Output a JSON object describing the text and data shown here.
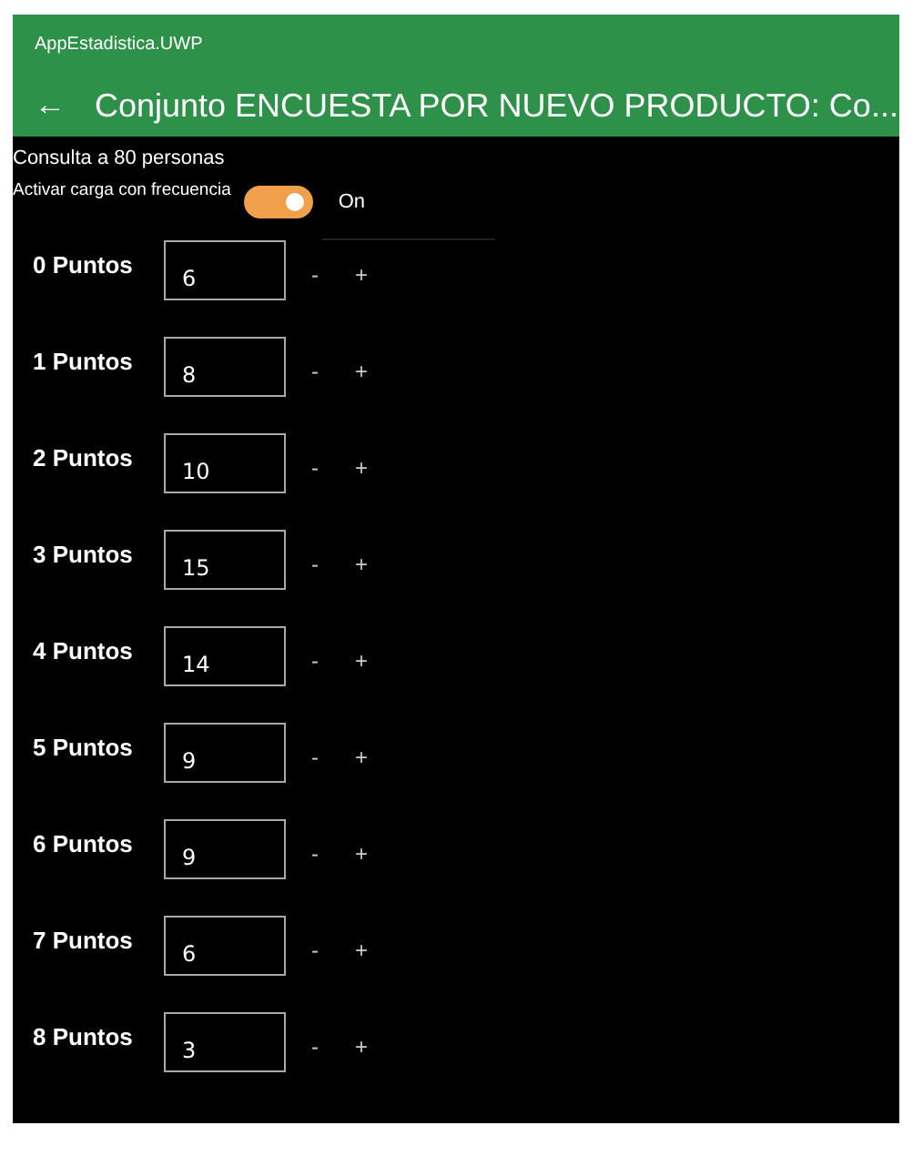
{
  "window": {
    "title": "AppEstadistica.UWP"
  },
  "header": {
    "back": "←",
    "title": "Conjunto ENCUESTA POR NUEVO PRODUCTO: Co..."
  },
  "summary": "Consulta a 80 personas",
  "toggle": {
    "label": "Activar carga con frecuencia",
    "on": true,
    "state_text": "On"
  },
  "rows": [
    {
      "label": "0 Puntos",
      "value": "6",
      "minus": "-",
      "plus": "+"
    },
    {
      "label": "1 Puntos",
      "value": "8",
      "minus": "-",
      "plus": "+"
    },
    {
      "label": "2 Puntos",
      "value": "10",
      "minus": "-",
      "plus": "+"
    },
    {
      "label": "3 Puntos",
      "value": "15",
      "minus": "-",
      "plus": "+"
    },
    {
      "label": "4 Puntos",
      "value": "14",
      "minus": "-",
      "plus": "+"
    },
    {
      "label": "5 Puntos",
      "value": "9",
      "minus": "-",
      "plus": "+"
    },
    {
      "label": "6 Puntos",
      "value": "9",
      "minus": "-",
      "plus": "+"
    },
    {
      "label": "7 Puntos",
      "value": "6",
      "minus": "-",
      "plus": "+"
    },
    {
      "label": "8 Puntos",
      "value": "3",
      "minus": "-",
      "plus": "+"
    }
  ]
}
